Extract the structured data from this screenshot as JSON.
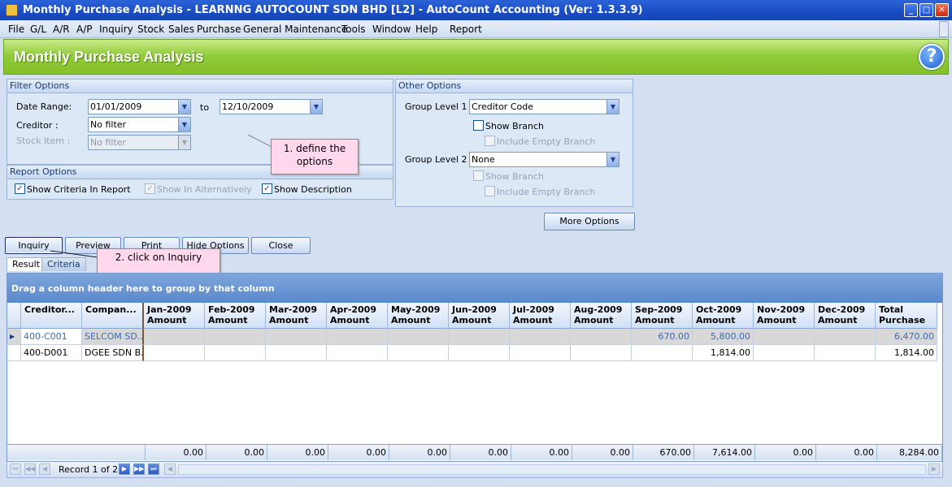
{
  "window": {
    "title": "Monthly Purchase Analysis - LEARNNG AUTOCOUNT SDN BHD [L2] - AutoCount Accounting (Ver: 1.3.3.9)"
  },
  "menu": [
    "File",
    "G/L",
    "A/R",
    "A/P",
    "Inquiry",
    "Stock",
    "Sales",
    "Purchase",
    "General Maintenance",
    "Tools",
    "Window",
    "Help",
    "Report"
  ],
  "header": {
    "title": "Monthly Purchase Analysis",
    "help_glyph": "?"
  },
  "filter": {
    "title": "Filter Options",
    "date_range_label": "Date Range:",
    "date_from": "01/01/2009",
    "to_label": "to",
    "date_to": "12/10/2009",
    "creditor_label": "Creditor :",
    "creditor_value": "No filter",
    "stock_item_label": "Stock Item :",
    "stock_item_value": "No filter"
  },
  "report_options": {
    "title": "Report Options",
    "show_criteria": "Show Criteria In Report",
    "show_in_alt": "Show In Alternatively",
    "show_description": "Show Description"
  },
  "other_options": {
    "title": "Other Options",
    "group1_label": "Group Level 1 :",
    "group1_value": "Creditor Code",
    "show_branch1": "Show Branch",
    "include_empty1": "Include Empty Branch",
    "group2_label": "Group Level 2 :",
    "group2_value": "None",
    "show_branch2": "Show Branch",
    "include_empty2": "Include Empty Branch"
  },
  "more_options": "More Options",
  "callouts": {
    "define": "1. define the options",
    "click": "2. click on Inquiry"
  },
  "buttons": {
    "inquiry": "Inquiry",
    "preview": "Preview",
    "print": "Print",
    "hide_options": "Hide Options",
    "close": "Close"
  },
  "tabs": {
    "result": "Result",
    "criteria": "Criteria"
  },
  "grid": {
    "group_hint": "Drag a column header here to group by that column",
    "headers": [
      "Creditor...",
      "Compan...",
      "Jan-2009 Amount",
      "Feb-2009 Amount",
      "Mar-2009 Amount",
      "Apr-2009 Amount",
      "May-2009 Amount",
      "Jun-2009 Amount",
      "Jul-2009 Amount",
      "Aug-2009 Amount",
      "Sep-2009 Amount",
      "Oct-2009 Amount",
      "Nov-2009 Amount",
      "Dec-2009 Amount",
      "Total Purchase"
    ],
    "rows": [
      [
        "400-C001",
        "SELCOM SD...",
        "",
        "",
        "",
        "",
        "",
        "",
        "",
        "",
        "670.00",
        "5,800.00",
        "",
        "",
        "6,470.00"
      ],
      [
        "400-D001",
        "DGEE SDN B...",
        "",
        "",
        "",
        "",
        "",
        "",
        "",
        "",
        "",
        "1,814.00",
        "",
        "",
        "1,814.00"
      ]
    ],
    "totals": [
      "0.00",
      "0.00",
      "0.00",
      "0.00",
      "0.00",
      "0.00",
      "0.00",
      "0.00",
      "670.00",
      "7,614.00",
      "0.00",
      "0.00",
      "8,284.00"
    ],
    "record_text": "Record 1 of 2"
  },
  "colors": {
    "title_bar": "#1a4cc4",
    "header_green": "#92cc3a",
    "selected_text": "#3a6ab8"
  }
}
